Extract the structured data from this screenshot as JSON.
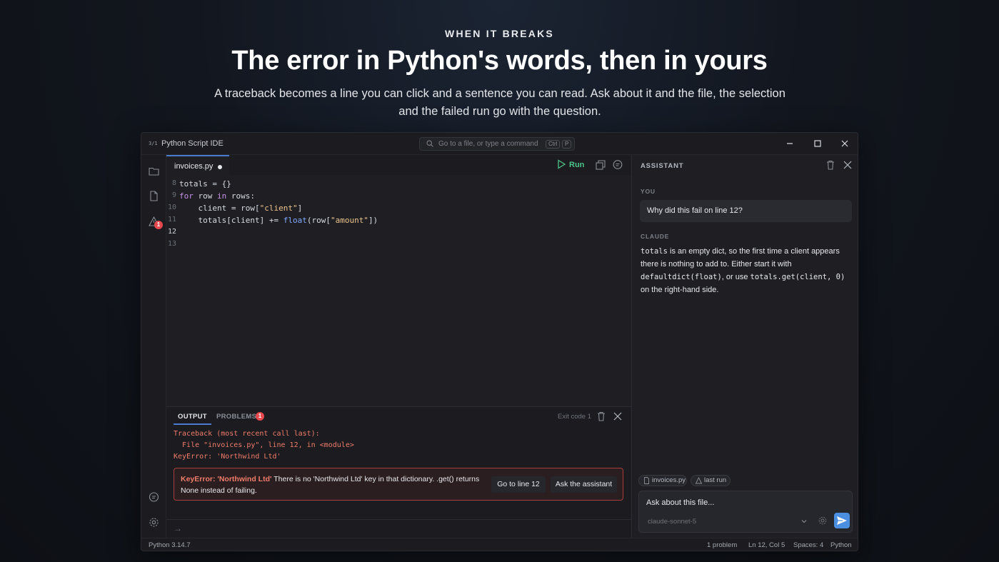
{
  "hero": {
    "eyebrow": "WHEN IT BREAKS",
    "headline": "The error in Python's words, then in yours",
    "subline": "A traceback becomes a line you can click and a sentence you can read. Ask about it and the file, the selection and the failed run go with the question."
  },
  "window": {
    "title": "Python Script IDE",
    "app_icon_text": "3/1",
    "command_placeholder": "Go to a file, or type a command",
    "shortcut_keys": [
      "Ctrl",
      "P"
    ]
  },
  "activity_bar": {
    "items": [
      "folder-icon",
      "file-icon",
      "warning-icon"
    ],
    "warning_badge": "1",
    "bottom_items": [
      "chat-icon",
      "settings-icon"
    ]
  },
  "editor": {
    "tab": {
      "name": "invoices.py",
      "modified": true
    },
    "run_label": "Run",
    "lines": [
      {
        "num": "8",
        "code": "totals = {}"
      },
      {
        "num": "9",
        "code": "for row in rows:"
      },
      {
        "num": "10",
        "code": "    client = row[\"client\"]"
      },
      {
        "num": "11",
        "code": "    totals[client] += float(row[\"amount\"])"
      },
      {
        "num": "12",
        "code": ""
      },
      {
        "num": "13",
        "code": ""
      }
    ],
    "active_line": "12"
  },
  "panel": {
    "tabs": [
      {
        "label": "OUTPUT",
        "active": true
      },
      {
        "label": "PROBLEMS",
        "badge": "1"
      }
    ],
    "exit_code": "Exit code 1",
    "traceback": [
      "Traceback (most recent call last):",
      "  File \"invoices.py\", line 12, in <module>",
      "KeyError: 'Northwind Ltd'"
    ],
    "error": {
      "title": "KeyError: 'Northwind Ltd'",
      "message": "There is no 'Northwind Ltd' key in that dictionary. .get() returns None instead of failing.",
      "goto_label": "Go to line 12",
      "ask_label": "Ask the assistant"
    },
    "prompt_symbol": "→"
  },
  "assistant": {
    "title": "ASSISTANT",
    "you_label": "YOU",
    "question": "Why did this fail on line 12?",
    "claude_label": "CLAUDE",
    "answer": {
      "code1": "totals",
      "text1": " is an empty dict, so the first time a client appears there is nothing to add to. Either start it with ",
      "code2": "defaultdict(float)",
      "text2": ", or use ",
      "code3": "totals.get(client, 0)",
      "text3": " on the right-hand side."
    },
    "chips": [
      "invoices.py",
      "last run"
    ],
    "input_placeholder": "Ask about this file...",
    "model": "claude-sonnet-5"
  },
  "statusbar": {
    "python_version": "Python 3.14.7",
    "problems": "1 problem",
    "cursor": "Ln 12, Col 5",
    "indent": "Spaces: 4",
    "language": "Python"
  },
  "colors": {
    "accent": "#4a8fe0",
    "run_green": "#4cc38a",
    "error_red": "#f07c6a",
    "badge_red": "#e5484d"
  }
}
